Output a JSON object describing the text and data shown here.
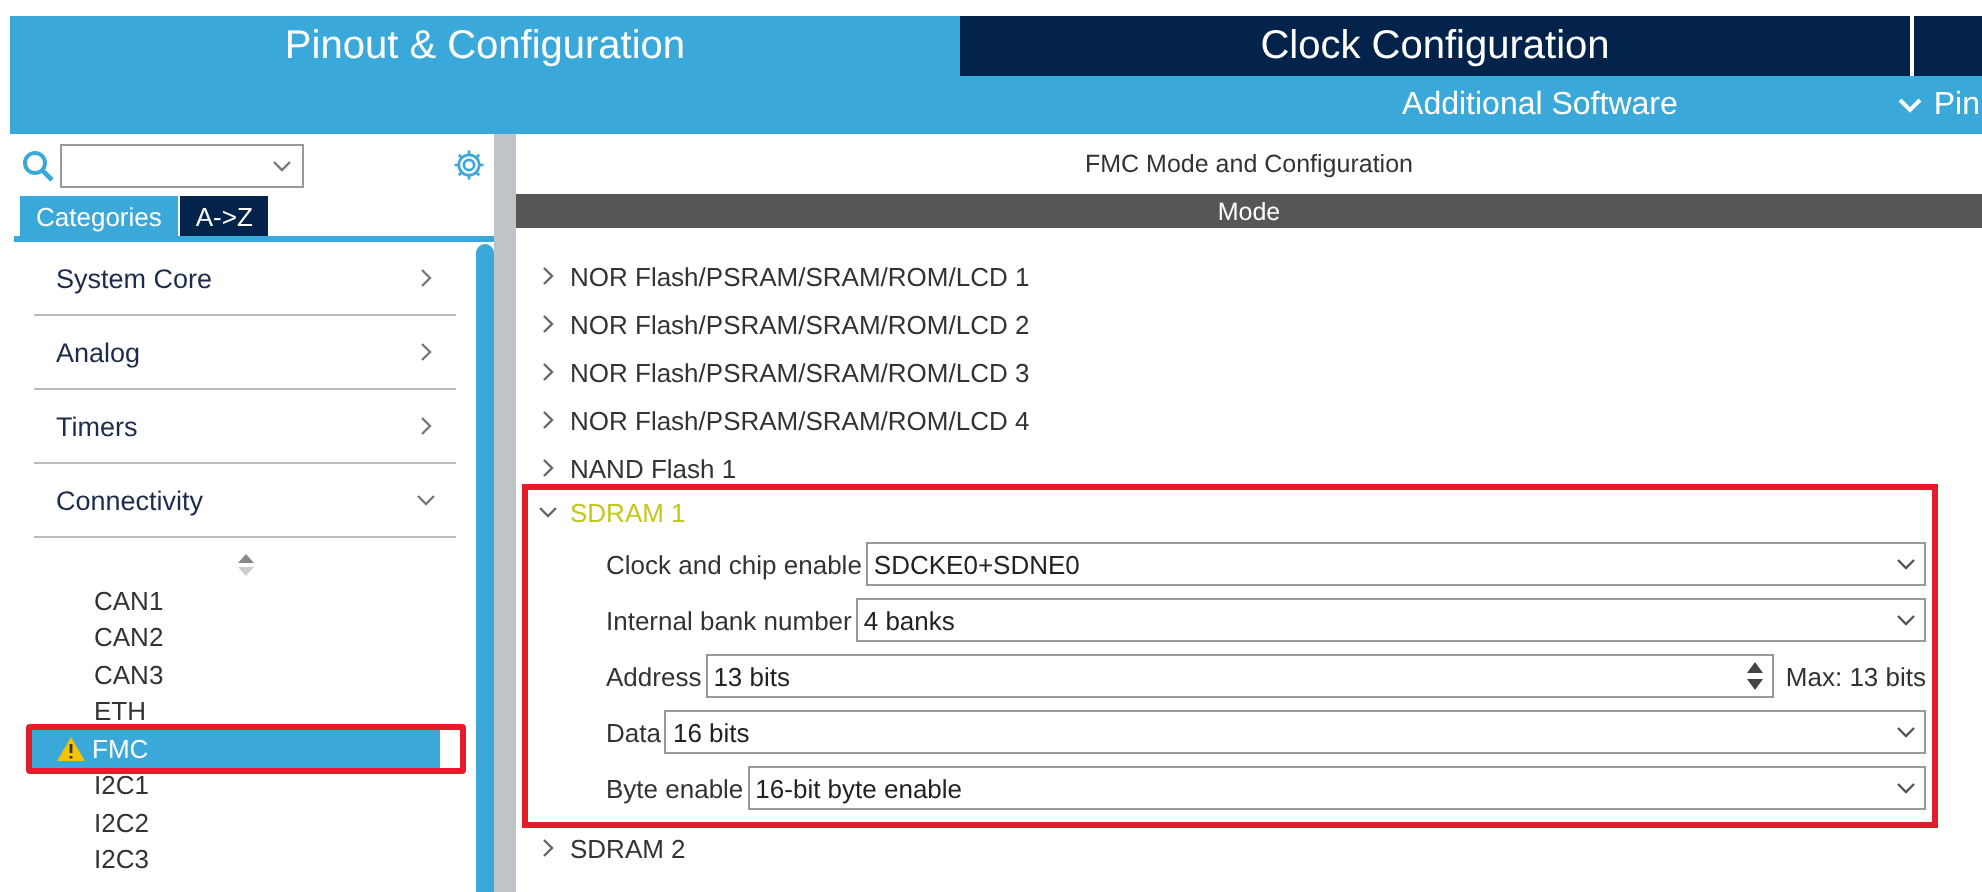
{
  "tabs": [
    {
      "label": "Pinout & Configuration",
      "selected": true
    },
    {
      "label": "Clock Configuration",
      "selected": false
    }
  ],
  "subtabs": [
    {
      "label": "Additional Software",
      "kind": "plain"
    },
    {
      "label": "Pin",
      "kind": "chevron"
    }
  ],
  "sidebar": {
    "view_tabs": [
      {
        "label": "Categories",
        "selected": true
      },
      {
        "label": "A->Z",
        "selected": false
      }
    ],
    "categories": [
      {
        "label": "System Core",
        "expanded": false
      },
      {
        "label": "Analog",
        "expanded": false
      },
      {
        "label": "Timers",
        "expanded": false
      },
      {
        "label": "Connectivity",
        "expanded": true,
        "children": [
          {
            "label": "CAN1",
            "selected": false,
            "warning": false,
            "highlighted": false
          },
          {
            "label": "CAN2",
            "selected": false,
            "warning": false,
            "highlighted": false
          },
          {
            "label": "CAN3",
            "selected": false,
            "warning": false,
            "highlighted": false
          },
          {
            "label": "ETH",
            "selected": false,
            "warning": false,
            "highlighted": false
          },
          {
            "label": "FMC",
            "selected": true,
            "warning": true,
            "highlighted": true
          },
          {
            "label": "I2C1",
            "selected": false,
            "warning": false,
            "highlighted": false
          },
          {
            "label": "I2C2",
            "selected": false,
            "warning": false,
            "highlighted": false
          },
          {
            "label": "I2C3",
            "selected": false,
            "warning": false,
            "highlighted": false
          }
        ]
      }
    ]
  },
  "content": {
    "title": "FMC Mode and Configuration",
    "header": "Mode",
    "sections": [
      {
        "label": "NOR Flash/PSRAM/SRAM/ROM/LCD 1",
        "expanded": false,
        "highlighted": false
      },
      {
        "label": "NOR Flash/PSRAM/SRAM/ROM/LCD 2",
        "expanded": false,
        "highlighted": false
      },
      {
        "label": "NOR Flash/PSRAM/SRAM/ROM/LCD 3",
        "expanded": false,
        "highlighted": false
      },
      {
        "label": "NOR Flash/PSRAM/SRAM/ROM/LCD 4",
        "expanded": false,
        "highlighted": false
      },
      {
        "label": "NAND Flash 1",
        "expanded": false,
        "highlighted": false
      },
      {
        "label": "SDRAM 1",
        "expanded": true,
        "highlighted": true,
        "fields": [
          {
            "kind": "select",
            "label": "Clock and chip enable",
            "value": "SDCKE0+SDNE0"
          },
          {
            "kind": "select",
            "label": "Internal bank number",
            "value": "4 banks"
          },
          {
            "kind": "spin",
            "label": "Address",
            "value": "13 bits",
            "note": "Max: 13 bits"
          },
          {
            "kind": "select",
            "label": "Data",
            "value": "16 bits"
          },
          {
            "kind": "select",
            "label": "Byte enable",
            "value": "16-bit byte enable"
          }
        ]
      },
      {
        "label": "SDRAM 2",
        "expanded": false,
        "highlighted": false
      }
    ]
  }
}
